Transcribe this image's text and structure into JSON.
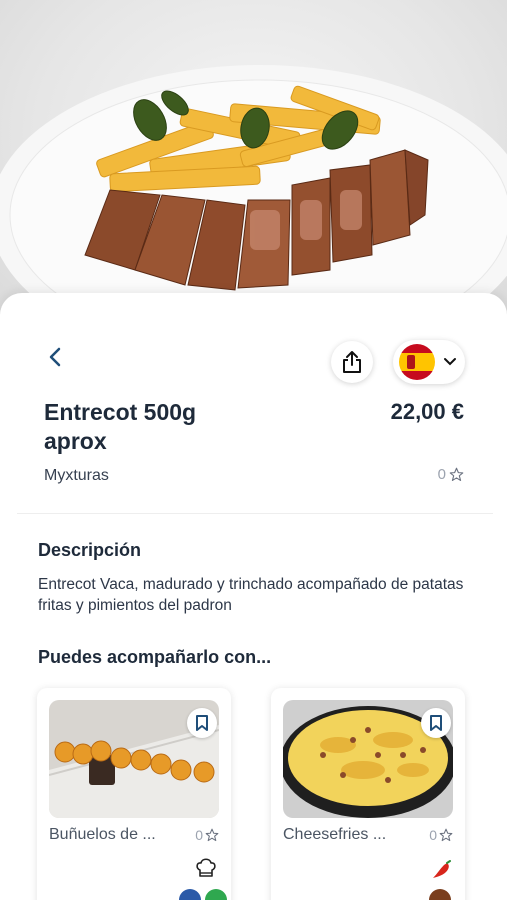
{
  "product": {
    "title": "Entrecot 500g aprox",
    "price": "22,00 €",
    "restaurant": "Myxturas",
    "rating": "0"
  },
  "description": {
    "heading": "Descripción",
    "text": "Entrecot Vaca, madurado y trinchado acompañado de patatas fritas y pimientos del padron"
  },
  "pairings": {
    "heading": "Puedes acompañarlo con...",
    "items": [
      {
        "name": "Buñuelos de ...",
        "rating": "0",
        "icons": [
          "chef-hat-icon",
          "allergen-blue-icon",
          "allergen-green-icon"
        ]
      },
      {
        "name": "Cheesefries ...",
        "rating": "0",
        "icons": [
          "chili-icon",
          "allergen-brown-icon"
        ]
      }
    ]
  },
  "language": {
    "flag": "spain-flag-icon"
  },
  "colors": {
    "heading": "#1e2a3a",
    "muted": "#9ca3af",
    "flag_red": "#c60b1e",
    "flag_yellow": "#ffc400"
  }
}
